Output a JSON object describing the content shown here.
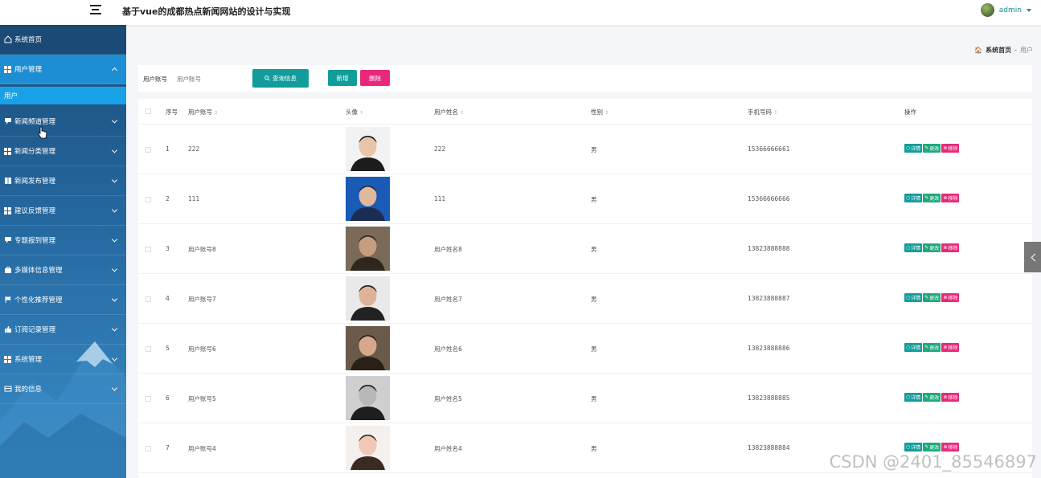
{
  "header": {
    "title": "基于vue的成都热点新闻网站的设计与实现",
    "username": "admin"
  },
  "sidebar": {
    "items": [
      {
        "label": "系统首页",
        "icon": "home-icon"
      },
      {
        "label": "用户管理",
        "icon": "grid-icon",
        "open": true,
        "sub": [
          {
            "label": "用户"
          }
        ]
      },
      {
        "label": "新闻频道管理",
        "icon": "comment-icon"
      },
      {
        "label": "新闻分类管理",
        "icon": "grid-icon"
      },
      {
        "label": "新闻发布管理",
        "icon": "book-icon"
      },
      {
        "label": "建议反馈管理",
        "icon": "grid-icon"
      },
      {
        "label": "专题报到管理",
        "icon": "comment-icon"
      },
      {
        "label": "多媒体信息管理",
        "icon": "briefcase-icon"
      },
      {
        "label": "个性化推荐管理",
        "icon": "flag-icon"
      },
      {
        "label": "订阅记录管理",
        "icon": "thumbs-up-icon"
      },
      {
        "label": "系统管理",
        "icon": "grid-icon"
      },
      {
        "label": "我的信息",
        "icon": "card-icon"
      }
    ]
  },
  "breadcrumb": {
    "home": "系统首页",
    "separator": "-",
    "current": "用户"
  },
  "search": {
    "label": "用户账号",
    "placeholder": "用户账号",
    "button": "查询信息"
  },
  "actions": {
    "add": "新增",
    "delete": "删除"
  },
  "table": {
    "headers": {
      "index": "序号",
      "account": "用户账号",
      "avatar": "头像",
      "name": "用户姓名",
      "gender": "性别",
      "phone": "手机号码",
      "ops": "操作"
    },
    "op_labels": {
      "detail": "详情",
      "edit": "更改",
      "remove": "移除"
    },
    "rows": [
      {
        "index": "1",
        "account": "222",
        "name": "222",
        "gender": "男",
        "phone": "15366666661"
      },
      {
        "index": "2",
        "account": "111",
        "name": "111",
        "gender": "男",
        "phone": "15366666666"
      },
      {
        "index": "3",
        "account": "用户账号8",
        "name": "用户姓名8",
        "gender": "男",
        "phone": "13823888888"
      },
      {
        "index": "4",
        "account": "用户账号7",
        "name": "用户姓名7",
        "gender": "男",
        "phone": "13823888887"
      },
      {
        "index": "5",
        "account": "用户账号6",
        "name": "用户姓名6",
        "gender": "男",
        "phone": "13823888886"
      },
      {
        "index": "6",
        "account": "用户账号5",
        "name": "用户姓名5",
        "gender": "男",
        "phone": "13823888885"
      },
      {
        "index": "7",
        "account": "用户账号4",
        "name": "用户姓名4",
        "gender": "男",
        "phone": "13823888884"
      }
    ]
  },
  "watermark": "CSDN @2401_85546897",
  "colors": {
    "primary": "#139c9c",
    "danger": "#e8287b",
    "sidebar_top": "#1c4d7a",
    "sidebar_active": "#1aa2e8"
  }
}
